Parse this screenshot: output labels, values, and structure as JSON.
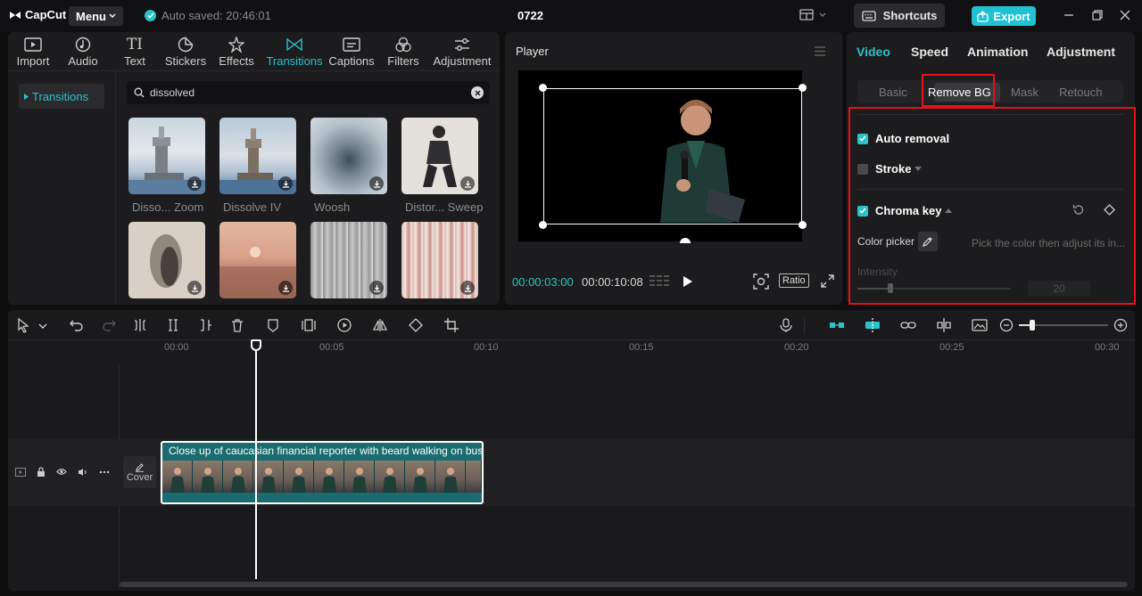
{
  "app": {
    "name": "CapCut",
    "menu_label": "Menu",
    "autosave_text": "Auto saved: 20:46:01",
    "project_title": "0722",
    "shortcuts_label": "Shortcuts",
    "export_label": "Export",
    "accent_color": "#2cc2c9",
    "highlight_color": "#e3121b"
  },
  "media_panel": {
    "tabs": [
      {
        "label": "Import",
        "icon": "import-icon"
      },
      {
        "label": "Audio",
        "icon": "audio-icon"
      },
      {
        "label": "Text",
        "icon": "text-icon"
      },
      {
        "label": "Stickers",
        "icon": "stickers-icon"
      },
      {
        "label": "Effects",
        "icon": "effects-icon"
      },
      {
        "label": "Transitions",
        "icon": "transitions-icon",
        "active": true
      },
      {
        "label": "Captions",
        "icon": "captions-icon"
      },
      {
        "label": "Filters",
        "icon": "filters-icon"
      },
      {
        "label": "Adjustment",
        "icon": "adjustment-icon"
      }
    ],
    "side_nav_label": "Transitions",
    "search_value": "dissolved",
    "items": [
      {
        "label": "Disso... Zoom"
      },
      {
        "label": "Dissolve IV"
      },
      {
        "label": "Woosh"
      },
      {
        "label": "Distor... Sweep"
      },
      {
        "label": ""
      },
      {
        "label": ""
      },
      {
        "label": ""
      },
      {
        "label": ""
      }
    ]
  },
  "player": {
    "title": "Player",
    "current_time": "00:00:03:00",
    "total_time": "00:00:10:08",
    "ratio_label": "Ratio"
  },
  "properties": {
    "tabs": [
      "Video",
      "Speed",
      "Animation",
      "Adjustment"
    ],
    "sub_tabs": [
      "Basic",
      "Remove BG",
      "Mask",
      "Retouch"
    ],
    "auto_removal_label": "Auto removal",
    "stroke_label": "Stroke",
    "chroma_key_label": "Chroma key",
    "color_picker_label": "Color picker",
    "color_picker_hint": "Pick the color then adjust its in...",
    "intensity_label": "Intensity",
    "intensity_value": "20"
  },
  "timeline": {
    "ticks": [
      "00:00",
      "00:05",
      "00:10",
      "00:15",
      "00:20",
      "00:25",
      "00:30"
    ],
    "clip_title": "Close up of caucasian financial reporter with beard walking on bus",
    "cover_label": "Cover"
  }
}
